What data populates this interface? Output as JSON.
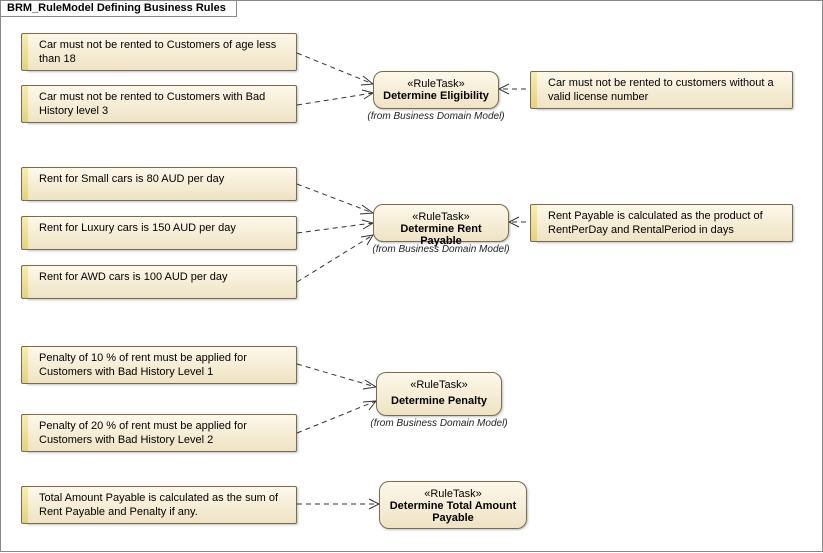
{
  "title": "BRM_RuleModel Defining Business Rules",
  "stereotype": "«RuleTask»",
  "from_text": "(from Business Domain Model)",
  "notes": {
    "n1": "Car must not be rented to Customers of age less than 18",
    "n2": "Car must not be rented to Customers with Bad History level 3",
    "n3": "Car must not be rented to customers without a valid license number",
    "n4": "Rent for Small cars is 80 AUD per day",
    "n5": "Rent for Luxury cars is 150 AUD per day",
    "n6": "Rent for AWD cars is 100 AUD per day",
    "n7": "Rent Payable is calculated as the product of RentPerDay and RentalPeriod in days",
    "n8": "Penalty of 10 % of rent must be applied for Customers with Bad History Level 1",
    "n9": "Penalty of 20 % of rent must be applied for Customers with Bad History Level 2",
    "n10": "Total Amount Payable is calculated as the sum of Rent Payable and Penalty if any."
  },
  "tasks": {
    "t1": "Determine Eligibility",
    "t2": "Determine Rent Payable",
    "t3": "Determine Penalty",
    "t4": "Determine Total Amount Payable"
  }
}
